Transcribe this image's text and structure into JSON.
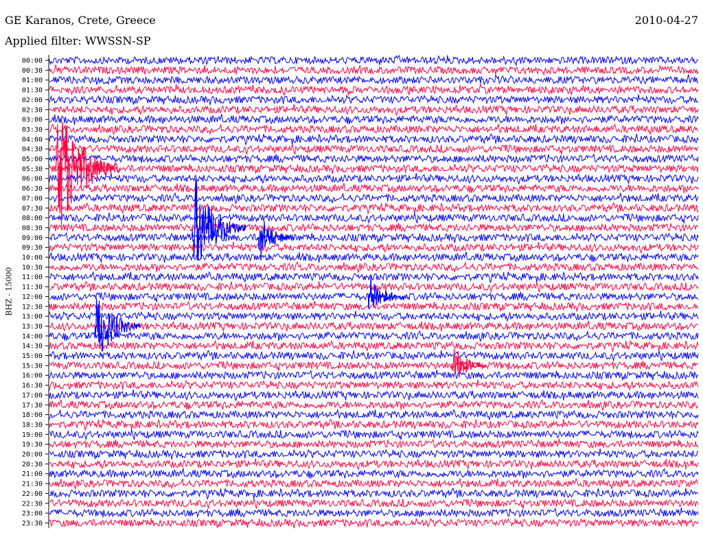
{
  "header": {
    "title": "GE Karanos, Crete, Greece",
    "date": "2010-04-27",
    "filter": "Applied filter: WWSSN-SP"
  },
  "chart_data": {
    "type": "line",
    "title": "GE Karanos, Crete, Greece",
    "xlabel": "",
    "ylabel": "BHZ - 15000",
    "time_labels": [
      "00:00",
      "00:30",
      "01:00",
      "01:30",
      "02:00",
      "02:30",
      "03:00",
      "03:30",
      "04:00",
      "04:30",
      "05:00",
      "05:30",
      "06:00",
      "06:30",
      "07:00",
      "07:30",
      "08:00",
      "08:30",
      "09:00",
      "09:30",
      "10:00",
      "10:30",
      "11:00",
      "11:30",
      "12:00",
      "12:30",
      "13:00",
      "13:30",
      "14:00",
      "14:30",
      "15:00",
      "15:30",
      "16:00",
      "16:30",
      "17:00",
      "17:30",
      "18:00",
      "18:30",
      "19:00",
      "19:30",
      "20:00",
      "20:30",
      "21:00",
      "21:30",
      "22:00",
      "22:30",
      "23:00",
      "23:30"
    ],
    "trace_colors": [
      "#0000ff",
      "#ff0040"
    ],
    "grid": false,
    "events": [
      {
        "row_label": "05:30",
        "time_in_row": 0.01,
        "amplitude": 8,
        "color": "#ff0040"
      },
      {
        "row_label": "08:30",
        "time_in_row": 0.22,
        "amplitude": 6,
        "color": "#0000ff"
      },
      {
        "row_label": "09:00",
        "time_in_row": 0.32,
        "amplitude": 3,
        "color": "#0000ff"
      },
      {
        "row_label": "12:00",
        "time_in_row": 0.49,
        "amplitude": 3,
        "color": "#0000ff"
      },
      {
        "row_label": "13:30",
        "time_in_row": 0.07,
        "amplitude": 4.5,
        "color": "#0000ff"
      },
      {
        "row_label": "15:30",
        "time_in_row": 0.62,
        "amplitude": 2.5,
        "color": "#ff0040"
      }
    ]
  }
}
